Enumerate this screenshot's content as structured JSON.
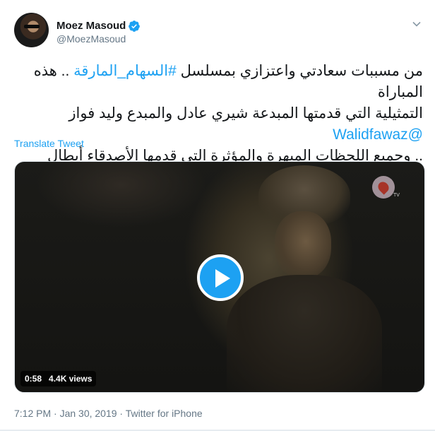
{
  "author": {
    "name": "Moez Masoud",
    "handle": "@MoezMasoud",
    "verified": true
  },
  "tweet": {
    "line1": "من مسببات سعادتي واعتزازي بمسلسل ",
    "hashtag": "#السهام_المارقة",
    "line1_end": " .. هذه المباراة",
    "line2": "التمثيلية التي قدمتها المبدعة شيري عادل والمبدع وليد فواز ",
    "mention": "@Walidfawaz",
    "line3": ".. وجميع اللحظات المبهرة والمؤثرة التي قدمها الأصدقاء أبطال العمل جميعا."
  },
  "translate_label": "Translate Tweet",
  "video": {
    "duration": "0:58",
    "views": "4.4K views",
    "channel_mark": "TV"
  },
  "meta": "7:12 PM · Jan 30, 2019 · Twitter for iPhone",
  "colors": {
    "link": "#1da1f2",
    "text": "#14171a",
    "secondary": "#657786"
  }
}
